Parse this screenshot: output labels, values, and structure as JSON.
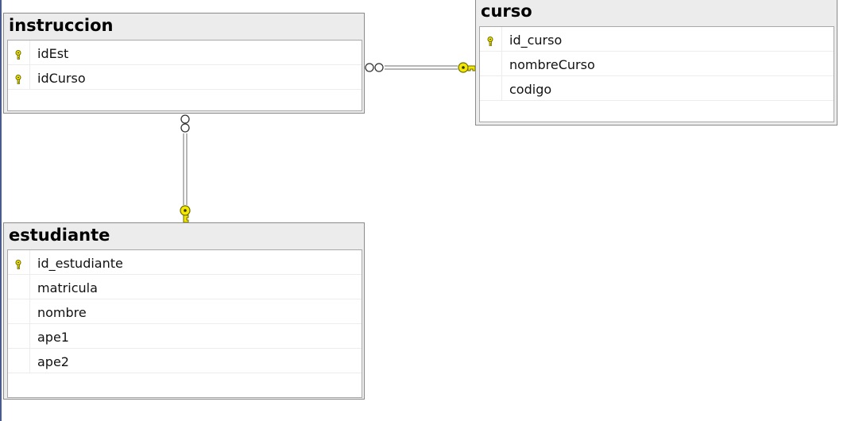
{
  "tables": {
    "instruccion": {
      "title": "instruccion",
      "columns": [
        {
          "name": "idEst",
          "pk": true
        },
        {
          "name": "idCurso",
          "pk": true
        }
      ]
    },
    "curso": {
      "title": "curso",
      "columns": [
        {
          "name": "id_curso",
          "pk": true
        },
        {
          "name": "nombreCurso",
          "pk": false
        },
        {
          "name": "codigo",
          "pk": false
        }
      ]
    },
    "estudiante": {
      "title": "estudiante",
      "columns": [
        {
          "name": "id_estudiante",
          "pk": true
        },
        {
          "name": "matricula",
          "pk": false
        },
        {
          "name": "nombre",
          "pk": false
        },
        {
          "name": "ape1",
          "pk": false
        },
        {
          "name": "ape2",
          "pk": false
        }
      ]
    }
  },
  "relationships": [
    {
      "from": "instruccion",
      "to": "curso",
      "from_end": "many",
      "to_end": "key"
    },
    {
      "from": "instruccion",
      "to": "estudiante",
      "from_end": "many",
      "to_end": "key"
    }
  ],
  "colors": {
    "key": "#f5e800",
    "key_outline": "#6a6a00",
    "line": "#6f6f6f"
  }
}
